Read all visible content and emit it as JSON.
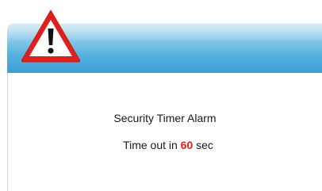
{
  "dialog": {
    "icon": "warning-triangle-icon",
    "title": "Security Timer Alarm",
    "countdown": {
      "prefix": "Time out in",
      "seconds": "60",
      "suffix": "sec"
    }
  },
  "colors": {
    "header_top": "#b9dcef",
    "header_bottom": "#3e9fd3",
    "warning_red": "#e0201c",
    "countdown_value": "#e0201c",
    "text": "#1a1a1a"
  }
}
